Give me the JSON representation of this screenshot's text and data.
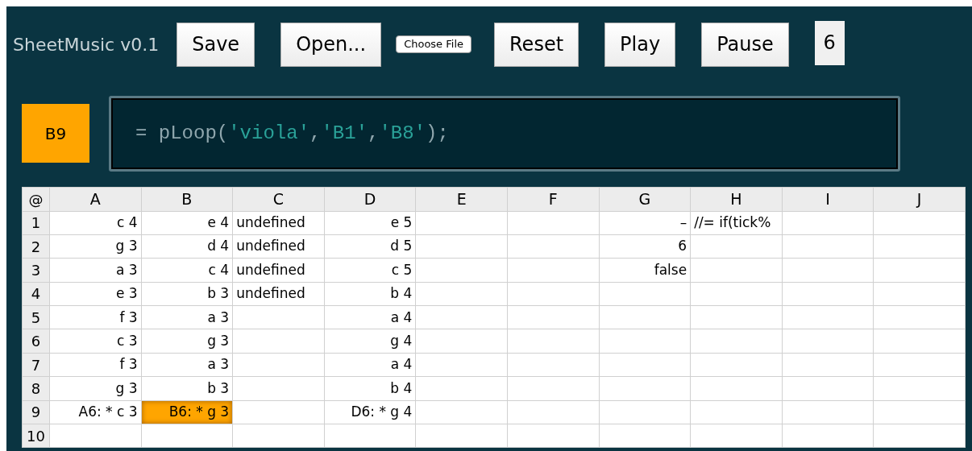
{
  "app_title": "SheetMusic v0.1",
  "toolbar": [
    {
      "kind": "button",
      "label": "Save"
    },
    {
      "kind": "button",
      "label": "Open..."
    },
    {
      "kind": "file",
      "label": "Choose File"
    },
    {
      "kind": "button",
      "label": "Reset"
    },
    {
      "kind": "button",
      "label": "Play"
    },
    {
      "kind": "button",
      "label": "Pause"
    },
    {
      "kind": "counter",
      "label": "6"
    }
  ],
  "cell_reference": "B9",
  "formula": [
    {
      "kind": "plain",
      "text": "= pLoop("
    },
    {
      "kind": "string",
      "text": "'viola'"
    },
    {
      "kind": "plain",
      "text": ","
    },
    {
      "kind": "string",
      "text": "'B1'"
    },
    {
      "kind": "plain",
      "text": ","
    },
    {
      "kind": "string",
      "text": "'B8'"
    },
    {
      "kind": "plain",
      "text": ");"
    }
  ],
  "table": {
    "corner": "@",
    "columns": [
      "A",
      "B",
      "C",
      "D",
      "E",
      "F",
      "G",
      "H",
      "I",
      "J"
    ],
    "rows": [
      {
        "label": "1",
        "cells": [
          {
            "text": "c 4",
            "kind": "value",
            "selected": false
          },
          {
            "text": "e 4",
            "kind": "value",
            "selected": false
          },
          {
            "text": "undefined",
            "kind": "text",
            "selected": false
          },
          {
            "text": "e 5",
            "kind": "value",
            "selected": false
          },
          {
            "kind": "empty",
            "selected": false
          },
          {
            "kind": "empty",
            "selected": false
          },
          {
            "text": "–",
            "kind": "value",
            "selected": false
          },
          {
            "text": "//= if(tick%",
            "kind": "text",
            "selected": false
          }
        ]
      },
      {
        "label": "2",
        "cells": [
          {
            "text": "g 3",
            "kind": "value",
            "selected": false
          },
          {
            "text": "d 4",
            "kind": "value",
            "selected": false
          },
          {
            "text": "undefined",
            "kind": "text",
            "selected": false
          },
          {
            "text": "d 5",
            "kind": "value",
            "selected": false
          },
          {
            "kind": "empty",
            "selected": false
          },
          {
            "kind": "empty",
            "selected": false
          },
          {
            "text": "6",
            "kind": "value",
            "selected": false
          }
        ]
      },
      {
        "label": "3",
        "cells": [
          {
            "text": "a 3",
            "kind": "value",
            "selected": false
          },
          {
            "text": "c 4",
            "kind": "value",
            "selected": false
          },
          {
            "text": "undefined",
            "kind": "text",
            "selected": false
          },
          {
            "text": "c 5",
            "kind": "value",
            "selected": false
          },
          {
            "kind": "empty",
            "selected": false
          },
          {
            "kind": "empty",
            "selected": false
          },
          {
            "text": "false",
            "kind": "value",
            "selected": false
          }
        ]
      },
      {
        "label": "4",
        "cells": [
          {
            "text": "e 3",
            "kind": "value",
            "selected": false
          },
          {
            "text": "b 3",
            "kind": "value",
            "selected": false
          },
          {
            "text": "undefined",
            "kind": "text",
            "selected": false
          },
          {
            "text": "b 4",
            "kind": "value",
            "selected": false
          }
        ]
      },
      {
        "label": "5",
        "cells": [
          {
            "text": "f 3",
            "kind": "value",
            "selected": false
          },
          {
            "text": "a 3",
            "kind": "value",
            "selected": false
          },
          {
            "kind": "empty",
            "selected": false
          },
          {
            "text": "a 4",
            "kind": "value",
            "selected": false
          }
        ]
      },
      {
        "label": "6",
        "cells": [
          {
            "text": "c 3",
            "kind": "value",
            "selected": false
          },
          {
            "text": "g 3",
            "kind": "value",
            "selected": false
          },
          {
            "kind": "empty",
            "selected": false
          },
          {
            "text": "g 4",
            "kind": "value",
            "selected": false
          }
        ]
      },
      {
        "label": "7",
        "cells": [
          {
            "text": "f 3",
            "kind": "value",
            "selected": false
          },
          {
            "text": "a 3",
            "kind": "value",
            "selected": false
          },
          {
            "kind": "empty",
            "selected": false
          },
          {
            "text": "a 4",
            "kind": "value",
            "selected": false
          }
        ]
      },
      {
        "label": "8",
        "cells": [
          {
            "text": "g 3",
            "kind": "value",
            "selected": false
          },
          {
            "text": "b 3",
            "kind": "value",
            "selected": false
          },
          {
            "kind": "empty",
            "selected": false
          },
          {
            "text": "b 4",
            "kind": "value",
            "selected": false
          }
        ]
      },
      {
        "label": "9",
        "cells": [
          {
            "text": "A6: * c 3",
            "kind": "value",
            "selected": false
          },
          {
            "text": "B6: * g 3",
            "kind": "value",
            "selected": true
          },
          {
            "kind": "empty",
            "selected": false
          },
          {
            "text": "D6: * g 4",
            "kind": "value",
            "selected": false
          }
        ]
      },
      {
        "label": "10"
      }
    ]
  }
}
